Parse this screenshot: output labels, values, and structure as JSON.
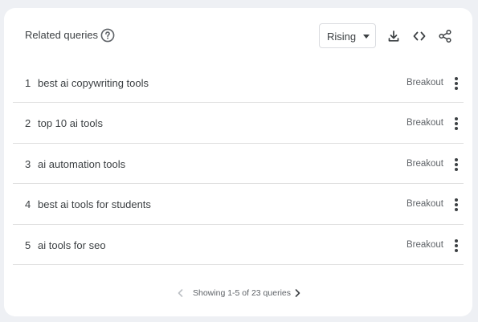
{
  "widget": {
    "title": "Related queries",
    "help_icon": "help-circle-icon",
    "filter": {
      "selected": "Rising",
      "icon": "caret-down-icon"
    },
    "toolbar_icons": [
      "download-icon",
      "embed-code-icon",
      "share-icon"
    ]
  },
  "rows": [
    {
      "rank": "1",
      "query": "best ai copywriting tools",
      "value": "Breakout"
    },
    {
      "rank": "2",
      "query": "top 10 ai tools",
      "value": "Breakout"
    },
    {
      "rank": "3",
      "query": "ai automation tools",
      "value": "Breakout"
    },
    {
      "rank": "4",
      "query": "best ai tools for students",
      "value": "Breakout"
    },
    {
      "rank": "5",
      "query": "ai tools for seo",
      "value": "Breakout"
    }
  ],
  "pagination": {
    "text": "Showing 1-5 of 23 queries"
  },
  "colors": {
    "text": "#3c4043",
    "muted": "#5f6368",
    "divider": "#e0e0e0",
    "background": "#eef0f4"
  }
}
